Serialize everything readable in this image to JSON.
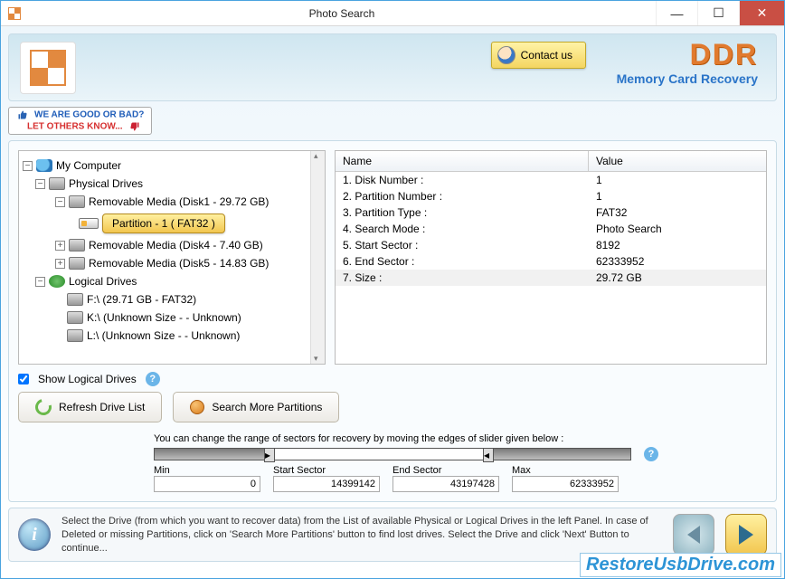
{
  "window": {
    "title": "Photo Search"
  },
  "header": {
    "contact_label": "Contact us",
    "brand": "DDR",
    "brand_sub": "Memory Card Recovery",
    "badge_line1": "WE ARE GOOD OR BAD?",
    "badge_line2": "LET OTHERS KNOW..."
  },
  "tree": {
    "root": "My Computer",
    "physical": "Physical Drives",
    "rm1": "Removable Media (Disk1 - 29.72 GB)",
    "part1": "Partition - 1 ( FAT32 )",
    "rm4": "Removable Media (Disk4 - 7.40 GB)",
    "rm5": "Removable Media (Disk5 - 14.83 GB)",
    "logical": "Logical Drives",
    "ld_f": "F:\\ (29.71 GB  -  FAT32)",
    "ld_k": "K:\\ (Unknown Size  -  - Unknown)",
    "ld_l": "L:\\ (Unknown Size  -  - Unknown)"
  },
  "details": {
    "head_name": "Name",
    "head_value": "Value",
    "rows": [
      {
        "n": "1. Disk Number :",
        "v": "1"
      },
      {
        "n": "2. Partition Number :",
        "v": "1"
      },
      {
        "n": "3. Partition Type :",
        "v": "FAT32"
      },
      {
        "n": "4. Search Mode :",
        "v": "Photo Search"
      },
      {
        "n": "5. Start Sector :",
        "v": "8192"
      },
      {
        "n": "6. End Sector :",
        "v": "62333952"
      },
      {
        "n": "7. Size :",
        "v": "29.72 GB"
      }
    ]
  },
  "controls": {
    "show_logical": "Show Logical Drives",
    "refresh": "Refresh Drive List",
    "search_more": "Search More Partitions"
  },
  "slider": {
    "caption": "You can change the range of sectors for recovery by moving the edges of slider given below :",
    "min_label": "Min",
    "min_val": "0",
    "start_label": "Start Sector",
    "start_val": "14399142",
    "end_label": "End Sector",
    "end_val": "43197428",
    "max_label": "Max",
    "max_val": "62333952"
  },
  "footer": {
    "text": "Select the Drive (from which you want to recover data) from the List of available Physical or Logical Drives in the left Panel. In case of Deleted or missing Partitions, click on 'Search More Partitions' button to find lost drives. Select the Drive and click 'Next' Button to continue..."
  },
  "watermark": "RestoreUsbDrive.com"
}
